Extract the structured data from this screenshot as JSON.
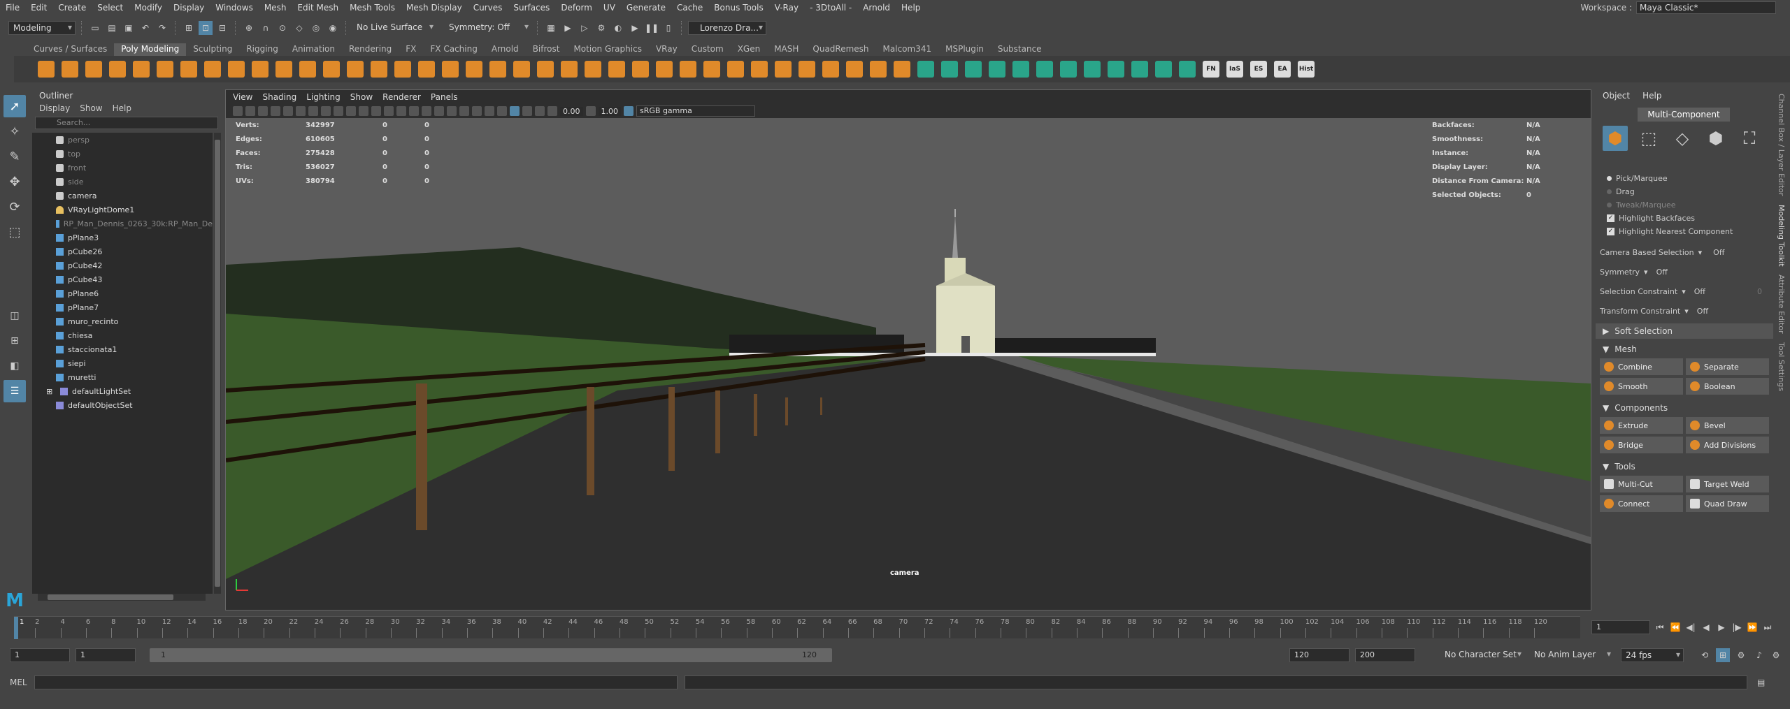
{
  "menubar": {
    "items": [
      "File",
      "Edit",
      "Create",
      "Select",
      "Modify",
      "Display",
      "Windows",
      "Mesh",
      "Edit Mesh",
      "Mesh Tools",
      "Mesh Display",
      "Curves",
      "Surfaces",
      "Deform",
      "UV",
      "Generate",
      "Cache",
      "Bonus Tools",
      "V-Ray",
      "- 3DtoAll -",
      "Arnold",
      "Help"
    ],
    "workspace_label": "Workspace :",
    "workspace_value": "Maya Classic*"
  },
  "statusline": {
    "mode": "Modeling",
    "live_surface": "No Live Surface",
    "symmetry": "Symmetry: Off",
    "user": "Lorenzo Dra..."
  },
  "shelf": {
    "tabs": [
      "Curves / Surfaces",
      "Poly Modeling",
      "Sculpting",
      "Rigging",
      "Animation",
      "Rendering",
      "FX",
      "FX Caching",
      "Arnold",
      "Bifrost",
      "Motion Graphics",
      "VRay",
      "Custom",
      "XGen",
      "MASH",
      "QuadRemesh",
      "Malcom341",
      "MSPlugin",
      "Substance"
    ],
    "active_tab": "Poly Modeling",
    "labels": [
      "FN",
      "IaS",
      "ES",
      "EA",
      "Hist"
    ]
  },
  "outliner": {
    "title": "Outliner",
    "menu": [
      "Display",
      "Show",
      "Help"
    ],
    "search_placeholder": "Search...",
    "items": [
      {
        "label": "persp",
        "dim": true,
        "icon": "camera-icon"
      },
      {
        "label": "top",
        "dim": true,
        "icon": "camera-icon"
      },
      {
        "label": "front",
        "dim": true,
        "icon": "camera-icon"
      },
      {
        "label": "side",
        "dim": true,
        "icon": "camera-icon"
      },
      {
        "label": "camera",
        "dim": false,
        "icon": "camera-icon"
      },
      {
        "label": "VRayLightDome1",
        "dim": false,
        "icon": "dome-light-icon"
      },
      {
        "label": "RP_Man_Dennis_0263_30k:RP_Man_De",
        "dim": true,
        "icon": "mesh-icon"
      },
      {
        "label": "pPlane3",
        "dim": false,
        "icon": "mesh-icon"
      },
      {
        "label": "pCube26",
        "dim": false,
        "icon": "mesh-icon"
      },
      {
        "label": "pCube42",
        "dim": false,
        "icon": "mesh-icon"
      },
      {
        "label": "pCube43",
        "dim": false,
        "icon": "mesh-icon"
      },
      {
        "label": "pPlane6",
        "dim": false,
        "icon": "mesh-icon"
      },
      {
        "label": "pPlane7",
        "dim": false,
        "icon": "mesh-icon"
      },
      {
        "label": "muro_recinto",
        "dim": false,
        "icon": "mesh-icon"
      },
      {
        "label": "chiesa",
        "dim": false,
        "icon": "mesh-icon"
      },
      {
        "label": "staccionata1",
        "dim": false,
        "icon": "mesh-icon"
      },
      {
        "label": "siepi",
        "dim": false,
        "icon": "mesh-icon"
      },
      {
        "label": "muretti",
        "dim": false,
        "icon": "mesh-icon"
      },
      {
        "label": "defaultLightSet",
        "dim": false,
        "icon": "set-icon",
        "expand": true
      },
      {
        "label": "defaultObjectSet",
        "dim": false,
        "icon": "set-icon"
      }
    ]
  },
  "viewport": {
    "menu": [
      "View",
      "Shading",
      "Lighting",
      "Show",
      "Renderer",
      "Panels"
    ],
    "exposure": "0.00",
    "gamma": "1.00",
    "color_space": "sRGB gamma",
    "camera_label": "camera",
    "stats": [
      {
        "label": "Verts:",
        "value": "342997",
        "a": "0",
        "b": "0"
      },
      {
        "label": "Edges:",
        "value": "610605",
        "a": "0",
        "b": "0"
      },
      {
        "label": "Faces:",
        "value": "275428",
        "a": "0",
        "b": "0"
      },
      {
        "label": "Tris:",
        "value": "536027",
        "a": "0",
        "b": "0"
      },
      {
        "label": "UVs:",
        "value": "380794",
        "a": "0",
        "b": "0"
      }
    ],
    "info": [
      {
        "label": "Backfaces:",
        "value": "N/A"
      },
      {
        "label": "Smoothness:",
        "value": "N/A"
      },
      {
        "label": "Instance:",
        "value": "N/A"
      },
      {
        "label": "Display Layer:",
        "value": "N/A"
      },
      {
        "label": "Distance From Camera:",
        "value": "N/A"
      },
      {
        "label": "Selected Objects:",
        "value": "0"
      }
    ]
  },
  "modeling_toolkit": {
    "menu": [
      "Object",
      "Help"
    ],
    "mode": "Multi-Component",
    "selection": [
      "Pick/Marquee",
      "Drag",
      "Tweak/Marquee"
    ],
    "highlight_backfaces": "Highlight Backfaces",
    "highlight_nearest": "Highlight Nearest Component",
    "camera_based_label": "Camera Based Selection",
    "camera_based_value": "Off",
    "symmetry_label": "Symmetry",
    "symmetry_value": "Off",
    "selection_constraint_label": "Selection Constraint",
    "selection_constraint_value": "Off",
    "selection_constraint_num": "0",
    "transform_constraint_label": "Transform Constraint",
    "transform_constraint_value": "Off",
    "soft_selection": "Soft Selection",
    "mesh_section": "Mesh",
    "mesh_tools": [
      "Combine",
      "Separate",
      "Smooth",
      "Boolean"
    ],
    "components_section": "Components",
    "component_tools": [
      "Extrude",
      "Bevel",
      "Bridge",
      "Add Divisions"
    ],
    "tools_section": "Tools",
    "tools": [
      "Multi-Cut",
      "Target Weld",
      "Connect",
      "Quad Draw"
    ]
  },
  "side_tabs": [
    "Channel Box / Layer Editor",
    "Modeling Toolkit",
    "Attribute Editor",
    "Tool Settings"
  ],
  "timeline": {
    "ticks": [
      2,
      4,
      6,
      8,
      10,
      12,
      14,
      16,
      18,
      20,
      22,
      24,
      26,
      28,
      30,
      32,
      34,
      36,
      38,
      40,
      42,
      44,
      46,
      48,
      50,
      52,
      54,
      56,
      58,
      60,
      62,
      64,
      66,
      68,
      70,
      72,
      74,
      76,
      78,
      80,
      82,
      84,
      86,
      88,
      90,
      92,
      94,
      96,
      98,
      100,
      102,
      104,
      106,
      108,
      110,
      112,
      114,
      116,
      118,
      120
    ],
    "current_frame": "1",
    "current_frame_marker": "1"
  },
  "range": {
    "start": "1",
    "playback_start": "1",
    "slider_start": "1",
    "slider_end": "120",
    "playback_end": "120",
    "end": "200",
    "character_set": "No Character Set",
    "anim_layer": "No Anim Layer",
    "fps": "24 fps"
  },
  "command": {
    "label": "MEL"
  }
}
